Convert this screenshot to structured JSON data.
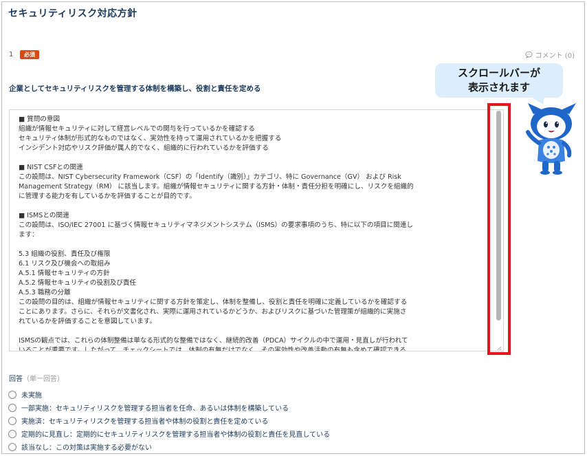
{
  "page": {
    "title": "セキュリティリスク対応方針"
  },
  "question": {
    "number": "1",
    "required_badge": "必須",
    "comment_label": "コメント (0)",
    "text": "企業としてセキュリティリスクを管理する体制を構築し、役割と責任を定める"
  },
  "description_lines": [
    "■ 質問の意図",
    "組織が情報セキュリティに対して経営レベルでの関与を行っているかを確認する",
    "セキュリティ体制が形式的なものではなく、実効性を持って運用されているかを把握する",
    "インシデント対応やリスク評価が属人的でなく、組織的に行われているかを評価する",
    "",
    "■ NIST CSFとの関連",
    "この設問は、NIST Cybersecurity Framework（CSF）の「Identify（識別）」カテゴリ、特に Governance（GV） および Risk",
    "Management Strategy（RM） に該当します。組織が情報セキュリティに関する方針・体制・責任分担を明確にし、リスクを組織的",
    "に管理する能力を有しているかを評価することが目的です。",
    "",
    "■ ISMSとの関連",
    "この設問は、ISO/IEC 27001 に基づく情報セキュリティマネジメントシステム（ISMS）の要求事項のうち、特に以下の項目に関連し",
    "ます：",
    "",
    "5.3 組織の役割、責任及び権限",
    "6.1 リスク及び機会への取組み",
    "A.5.1 情報セキュリティの方針",
    "A.5.2 情報セキュリティの役割及び責任",
    "A.5.3 職務の分離",
    "この設問の目的は、組織が情報セキュリティに関する方針を策定し、体制を整備し、役割と責任を明確に定義しているかを確認する",
    "ことにあります。さらに、それらが文書化され、実際に運用されているかどうか、およびリスクに基づいた管理策が組織的に実施さ",
    "れているかを評価することを意図しています。",
    "",
    "ISMSの観点では、これらの体制整備は単なる形式的な整備ではなく、継続的改善（PDCA）サイクルの中で運用・見直しが行われて",
    "いることが重要です。したがって、チェックシートでは、体制の有無だけでなく、その実効性や改善活動の有無も含めて確認できる"
  ],
  "callout": {
    "line1": "スクロールバーが",
    "line2": "表示されます"
  },
  "answer": {
    "label": "回答",
    "sub_label": "（単一回答）",
    "options": [
      "未実施",
      "一部実施：セキュリティリスクを管理する担当者を任命、あるいは体制を構築している",
      "実施済：セキュリティリスクを管理する担当者や体制の役割と責任を定めている",
      "定期的に見直し：定期的にセキュリティリスクを管理する担当者や体制の役割と責任を見直している",
      "該当なし：この対策は実施する必要がない"
    ]
  },
  "colors": {
    "required": "#d9480f",
    "highlight": "#e8141b",
    "callout_bg": "#dceefb",
    "heading": "#1b3a5c"
  },
  "icons": {
    "comment": "speech-bubble-icon",
    "mascot": "mascot-character"
  }
}
